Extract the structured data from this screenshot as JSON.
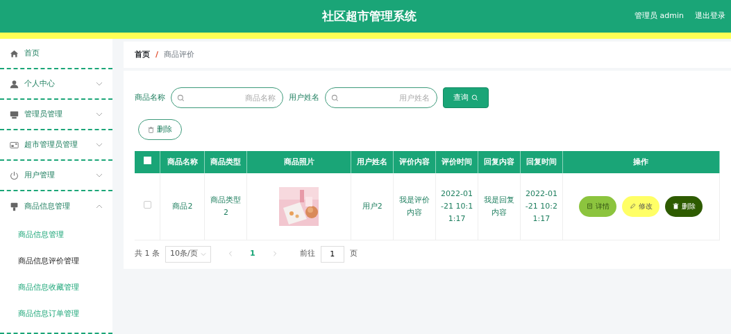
{
  "header": {
    "title": "社区超市管理系统",
    "user": "管理员 admin",
    "logout": "退出登录"
  },
  "sidebar": {
    "items": [
      {
        "label": "首页"
      },
      {
        "label": "个人中心",
        "expanded": false
      },
      {
        "label": "管理员管理",
        "expanded": false
      },
      {
        "label": "超市管理员管理",
        "expanded": false
      },
      {
        "label": "用户管理",
        "expanded": false
      },
      {
        "label": "商品信息管理",
        "expanded": true,
        "children": [
          {
            "label": "商品信息管理",
            "selected": false
          },
          {
            "label": "商品信息评价管理",
            "selected": true
          },
          {
            "label": "商品信息收藏管理",
            "selected": false
          },
          {
            "label": "商品信息订单管理",
            "selected": false
          }
        ]
      }
    ]
  },
  "breadcrumb": {
    "separator": "/",
    "items": [
      {
        "label": "首页"
      },
      {
        "label": "商品评价"
      }
    ]
  },
  "search": {
    "fields": [
      {
        "label": "商品名称",
        "placeholder": "商品名称"
      },
      {
        "label": "用户姓名",
        "placeholder": "用户姓名"
      }
    ],
    "button": "查询"
  },
  "delete_button": "删除",
  "table": {
    "header_checkbox": {
      "checked": false
    },
    "columns": [
      "商品名称",
      "商品类型",
      "商品照片",
      "用户姓名",
      "评价内容",
      "评价时间",
      "回复内容",
      "回复时间",
      "操作"
    ],
    "rows": [
      {
        "checked": false,
        "cells": [
          "商品2",
          "商品类型2",
          {
            "kind": "picture"
          },
          "用户2",
          "我是评价内容",
          "2022-01-21 10:11:17",
          "我是回复内容",
          "2022-01-21 10:21:17"
        ],
        "actions": [
          {
            "kind": "detail",
            "label": "详情"
          },
          {
            "kind": "edit",
            "label": "修改"
          },
          {
            "kind": "delete",
            "label": "删除"
          }
        ]
      }
    ]
  },
  "pagination": {
    "total": "共 1 条",
    "page_size": "10条/页",
    "pages": [
      {
        "label": "1",
        "selected": true
      }
    ],
    "goto_label": "前往",
    "goto_value": "1",
    "goto_suffix": "页"
  }
}
